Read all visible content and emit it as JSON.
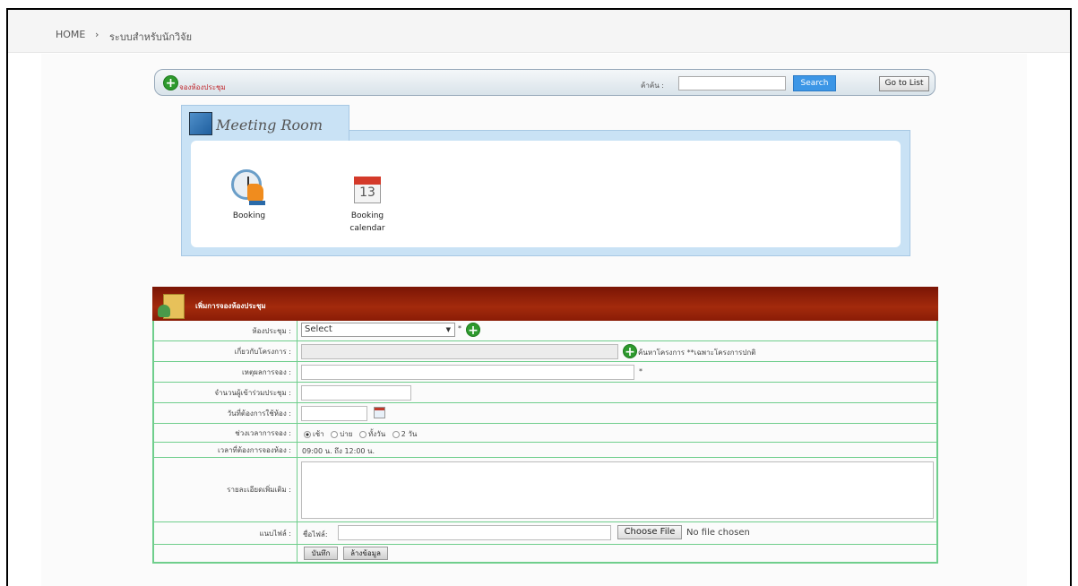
{
  "breadcrumb": {
    "home": "HOME",
    "separator": "›",
    "current": "ระบบสำหรับนักวิจัย"
  },
  "toolbar": {
    "add_icon": "plus-circle-icon",
    "add_label": "จองห้องประชุม",
    "search_label": "ค้าค้น :",
    "search_value": "",
    "search_button": "Search",
    "goto_button": "Go to List"
  },
  "meeting_room": {
    "title": "Meeting Room",
    "tiles": [
      {
        "label": "Booking",
        "icon": "clock-hand-icon"
      },
      {
        "label_line1": "Booking",
        "label_line2": "calendar",
        "icon": "calendar-icon",
        "calendar_day": "13"
      }
    ]
  },
  "form": {
    "header_title": "เพิ่มการจองห้องประชุม",
    "rows": {
      "room": {
        "label": "ห้องประชุม :",
        "select_value": "Select",
        "required": "*"
      },
      "project": {
        "label": "เกี่ยวกับโครงการ :",
        "value": "",
        "search_note": "ค้นหาโครงการ **เฉพาะโครงการปกติ"
      },
      "reason": {
        "label": "เหตุผลการจอง :",
        "value": "",
        "required": "*"
      },
      "attendees": {
        "label": "จำนวนผู้เข้าร่วมประชุม :",
        "value": ""
      },
      "date": {
        "label": "วันที่ต้องการใช้ห้อง :",
        "value": ""
      },
      "period": {
        "label": "ช่วงเวลาการจอง :",
        "options": [
          "เช้า",
          "บ่าย",
          "ทั้งวัน",
          "2 วัน"
        ],
        "selected": "เช้า"
      },
      "time": {
        "label": "เวลาที่ต้องการจองห้อง :",
        "value": "09:00 น. ถึง 12:00 น."
      },
      "details": {
        "label": "รายละเอียดเพิ่มเติม :",
        "value": ""
      },
      "attachment": {
        "label": "แนบไฟล์ :",
        "file_name_label": "ชื่อไฟล์:",
        "file_name_value": "",
        "choose_button": "Choose File",
        "no_file": "No file chosen"
      }
    },
    "save_button": "บันทึก",
    "clear_button": "ล้างข้อมูล"
  },
  "colors": {
    "header_red": "#8a1c06",
    "table_border": "#6fce8c",
    "search_blue": "#3c96e6",
    "panel_blue": "#c9e2f5",
    "add_green": "#2e9a2e"
  }
}
